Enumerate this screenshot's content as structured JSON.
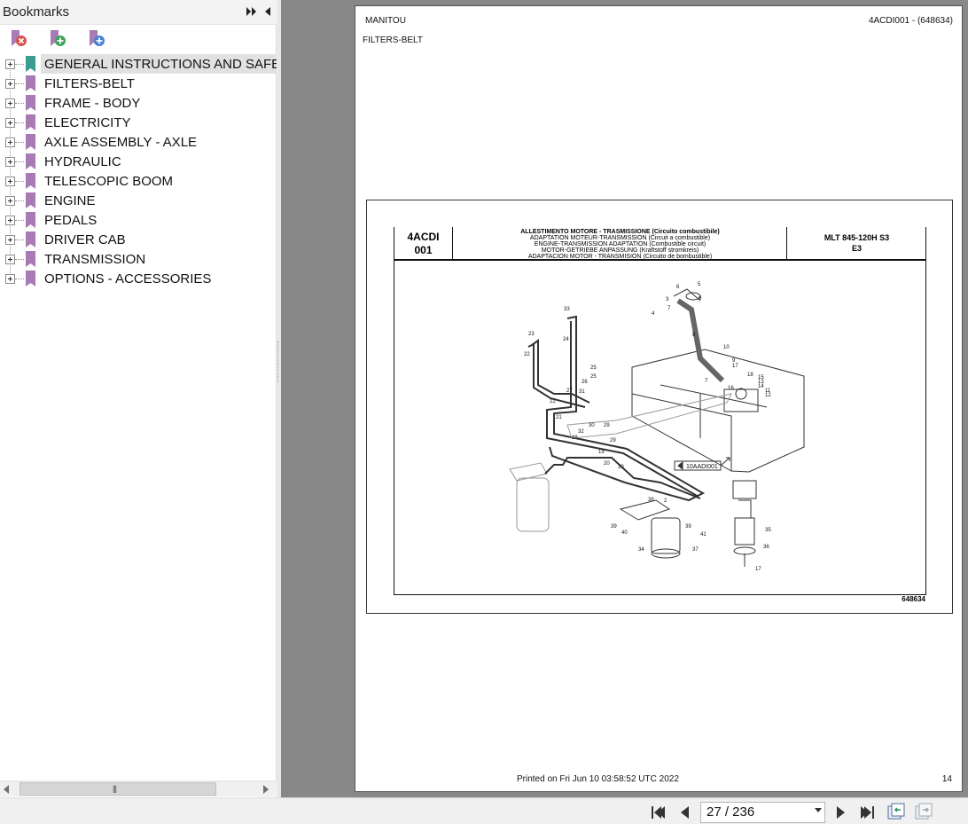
{
  "sidebar": {
    "title": "Bookmarks",
    "items": [
      {
        "label": "GENERAL INSTRUCTIONS AND SAFETY",
        "selected": true,
        "icon": "bookmark-teal-icon"
      },
      {
        "label": "FILTERS-BELT",
        "icon": "bookmark-icon"
      },
      {
        "label": "FRAME - BODY",
        "icon": "bookmark-icon"
      },
      {
        "label": "ELECTRICITY",
        "icon": "bookmark-icon"
      },
      {
        "label": "AXLE ASSEMBLY - AXLE",
        "icon": "bookmark-icon"
      },
      {
        "label": "HYDRAULIC",
        "icon": "bookmark-icon"
      },
      {
        "label": "TELESCOPIC BOOM",
        "icon": "bookmark-icon"
      },
      {
        "label": "ENGINE",
        "icon": "bookmark-icon"
      },
      {
        "label": "PEDALS",
        "icon": "bookmark-icon"
      },
      {
        "label": "DRIVER CAB",
        "icon": "bookmark-icon"
      },
      {
        "label": "TRANSMISSION",
        "icon": "bookmark-icon"
      },
      {
        "label": "OPTIONS - ACCESSORIES",
        "icon": "bookmark-icon"
      }
    ]
  },
  "page": {
    "brand": "MANITOU",
    "reference": "4ACDI001 - (648634)",
    "section": "FILTERS-BELT",
    "printed": "Printed on  Fri Jun 10 03:58:52 UTC 2022",
    "number": "14"
  },
  "figure": {
    "code_line1": "4ACDI",
    "code_line2": "001",
    "title_lines": [
      "ALLESTIMENTO MOTORE - TRASMISSIONE (Circuito combustibile)",
      "ADAPTATION MOTEUR-TRANSMISSION (Circuit a combustible)",
      "ENGINE-TRANSMISSION ADAPTATION (Combustible circuit)",
      "MOTOR-GETRIEBE ANPASSUNG (Kraftstoff stromkreis)",
      "ADAPTACION MOTOR - TRANSMISION (Circuito de bombustible)"
    ],
    "model": "MLT 845-120H S3",
    "revision": "E3",
    "drawing_code": "648634",
    "callout": "10AADI001",
    "part_numbers": [
      "6",
      "5",
      "9",
      "3",
      "7",
      "4",
      "8",
      "10",
      "9",
      "17",
      "18",
      "15",
      "13",
      "14",
      "11",
      "12",
      "16",
      "7",
      "33",
      "23",
      "24",
      "22",
      "25",
      "25",
      "26",
      "27",
      "31",
      "22",
      "21",
      "30",
      "32",
      "28",
      "29",
      "29",
      "19",
      "20",
      "20",
      "38",
      "2",
      "39",
      "40",
      "41",
      "34",
      "39",
      "37",
      "35",
      "36",
      "17"
    ]
  },
  "nav": {
    "page_indicator": "27 / 236"
  },
  "colors": {
    "bookmark": "#a87bb5",
    "bookmark_selected": "#3a9d8f",
    "viewer_bg": "#888888",
    "nav_arrow": "#333333",
    "icon_red": "#d9534f",
    "icon_green": "#3aa55a",
    "icon_blue": "#4a7fd1"
  }
}
